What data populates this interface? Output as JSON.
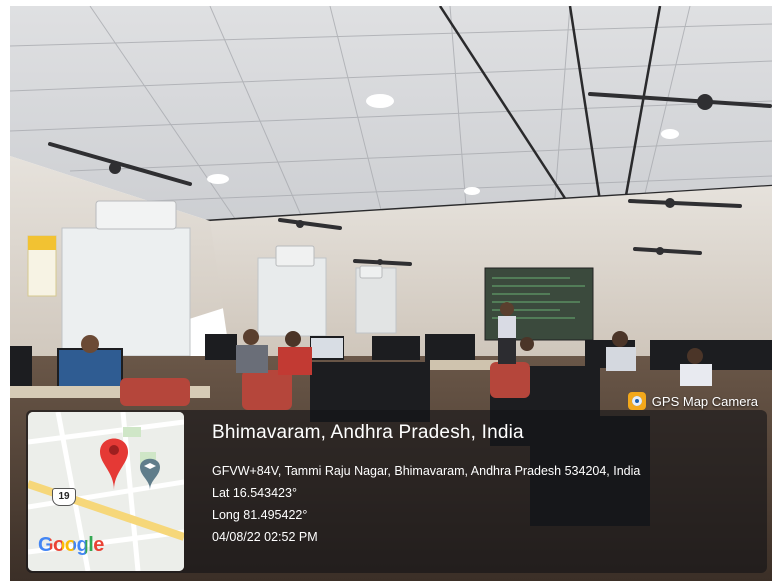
{
  "watermark": {
    "label": "GPS Map Camera",
    "icon": "gps-map-camera-icon"
  },
  "location": {
    "place": "Bhimavaram, Andhra Pradesh, India",
    "address": "GFVW+84V, Tammi Raju Nagar, Bhimavaram, Andhra Pradesh 534204, India",
    "lat": "Lat 16.543423°",
    "long": "Long 81.495422°",
    "datetime": "04/08/22 02:52 PM"
  },
  "map": {
    "route_badge": "19",
    "brand": "Google",
    "pin_icon": "map-pin-icon",
    "poi_icon": "graduation-cap-icon"
  },
  "colors": {
    "pin": "#e53935",
    "poi": "#607d8b",
    "road": "#f6d77a"
  }
}
